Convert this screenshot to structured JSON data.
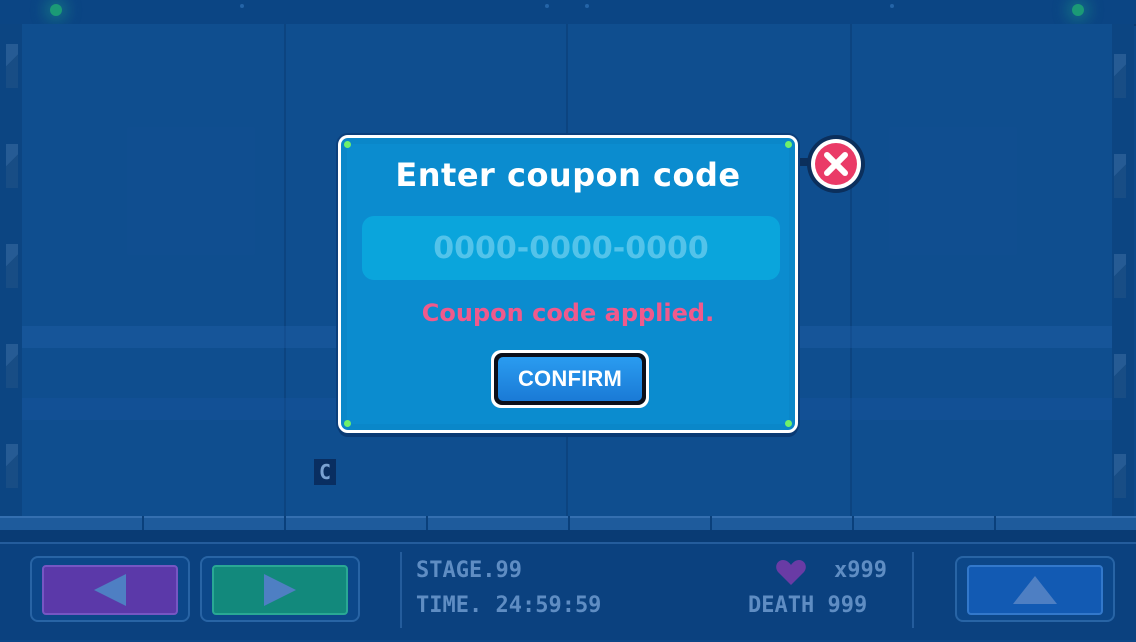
{
  "dialog": {
    "title": "Enter coupon code",
    "input_placeholder": "0000-0000-0000",
    "input_value": "",
    "status_message": "Coupon code applied.",
    "confirm_label": "CONFIRM",
    "close_icon": "close-icon"
  },
  "scene": {
    "tile_letter": "C"
  },
  "hud": {
    "stage_label": "STAGE.99",
    "time_label": "TIME. 24:59:59",
    "lives": "x999",
    "death_label": "DEATH 999",
    "left_button_icon": "arrow-left-icon",
    "right_button_icon": "arrow-right-icon",
    "jump_button_icon": "arrow-up-icon",
    "lives_icon": "heart-icon"
  },
  "colors": {
    "dialog_bg": "#0b8ccf",
    "status_message": "#f05a8c",
    "close_button": "#ea3a67",
    "left_button": "#6a3db8",
    "right_button": "#159a83",
    "jump_button": "#1463c4"
  }
}
